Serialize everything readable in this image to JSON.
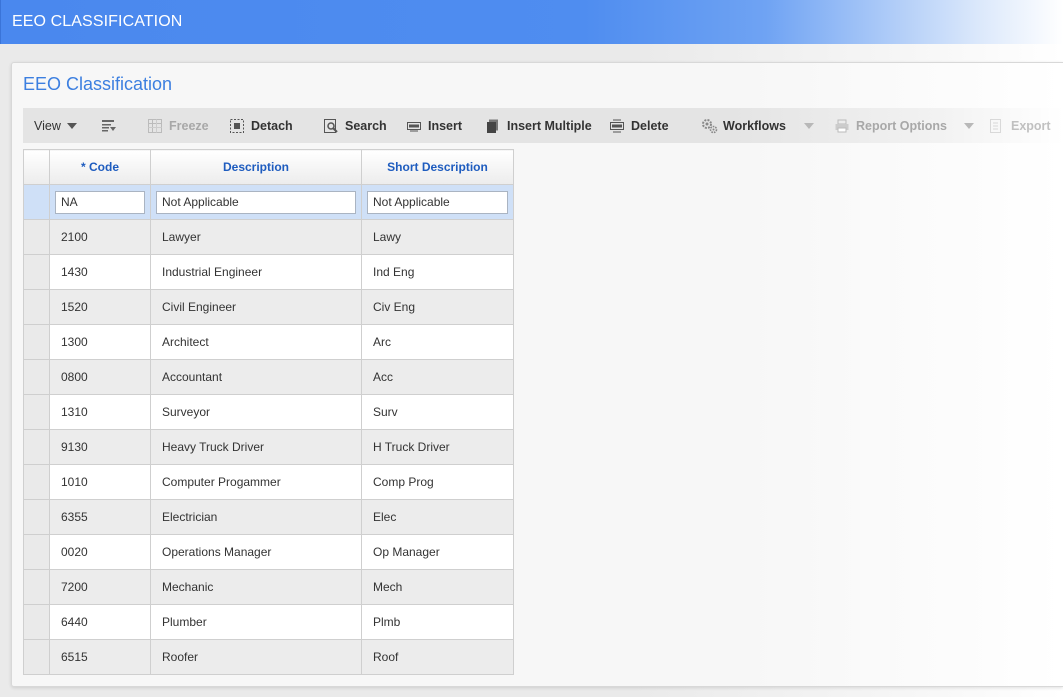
{
  "window": {
    "title": "EEO CLASSIFICATION"
  },
  "panel": {
    "title": "EEO Classification"
  },
  "toolbar": {
    "view_label": "View",
    "freeze_label": "Freeze",
    "detach_label": "Detach",
    "search_label": "Search",
    "insert_label": "Insert",
    "insert_multiple_label": "Insert Multiple",
    "delete_label": "Delete",
    "workflows_label": "Workflows",
    "report_options_label": "Report Options",
    "export_label": "Export"
  },
  "table": {
    "columns": {
      "code": "* Code",
      "description": "Description",
      "short_description": "Short Description"
    },
    "edit_row": {
      "code": "NA",
      "description": "Not Applicable",
      "short_description": "Not Applicable"
    },
    "rows": [
      {
        "code": "2100",
        "description": "Lawyer",
        "short_description": "Lawy"
      },
      {
        "code": "1430",
        "description": "Industrial Engineer",
        "short_description": "Ind Eng"
      },
      {
        "code": "1520",
        "description": "Civil Engineer",
        "short_description": "Civ Eng"
      },
      {
        "code": "1300",
        "description": "Architect",
        "short_description": "Arc"
      },
      {
        "code": "0800",
        "description": "Accountant",
        "short_description": "Acc"
      },
      {
        "code": "1310",
        "description": "Surveyor",
        "short_description": "Surv"
      },
      {
        "code": "9130",
        "description": "Heavy Truck Driver",
        "short_description": "H Truck Driver"
      },
      {
        "code": "1010",
        "description": "Computer Progammer",
        "short_description": "Comp Prog"
      },
      {
        "code": "6355",
        "description": "Electrician",
        "short_description": "Elec"
      },
      {
        "code": "0020",
        "description": "Operations Manager",
        "short_description": "Op Manager"
      },
      {
        "code": "7200",
        "description": "Mechanic",
        "short_description": "Mech"
      },
      {
        "code": "6440",
        "description": "Plumber",
        "short_description": "Plmb"
      },
      {
        "code": "6515",
        "description": "Roofer",
        "short_description": "Roof"
      }
    ]
  },
  "colors": {
    "title_bar": "#4a88ee",
    "panel_title": "#3c7fe0",
    "column_header_text": "#1e5cbf",
    "selected_row": "#cfe0f7"
  },
  "icons": [
    "column-settings-icon",
    "freeze-icon",
    "detach-icon",
    "search-icon",
    "insert-icon",
    "insert-multiple-icon",
    "delete-icon",
    "workflows-icon",
    "print-icon",
    "export-icon"
  ]
}
